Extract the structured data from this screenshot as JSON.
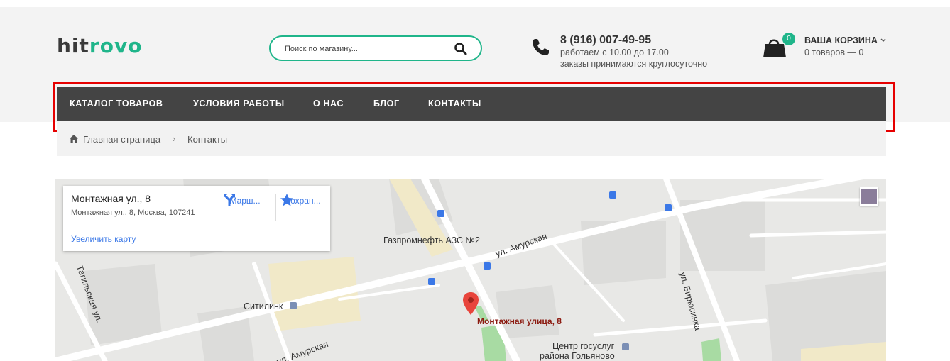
{
  "logo": {
    "prefix": "hit",
    "suffix": "rovo"
  },
  "search": {
    "placeholder": "Поиск по магазину..."
  },
  "contact": {
    "phone": "8 (916) 007-49-95",
    "hours": "работаем с 10.00 до 17.00",
    "orders": "заказы принимаются круглосуточно"
  },
  "cart": {
    "title": "ВАША КОРЗИНА",
    "count": "0",
    "summary": "0 товаров — 0"
  },
  "nav": {
    "items": [
      {
        "label": "КАТАЛОГ ТОВАРОВ"
      },
      {
        "label": "УСЛОВИЯ РАБОТЫ"
      },
      {
        "label": "О НАС"
      },
      {
        "label": "БЛОГ"
      },
      {
        "label": "КОНТАКТЫ"
      }
    ]
  },
  "breadcrumb": {
    "home": "Главная страница",
    "current": "Контакты"
  },
  "map": {
    "card": {
      "title": "Монтажная ул., 8",
      "address": "Монтажная ул., 8, Москва, 107241",
      "route": "Марш...",
      "save": "Сохран...",
      "enlarge": "Увеличить карту"
    },
    "labels": {
      "gas_station": "Газпромнефть АЗС №2",
      "amurskaya_top": "ул. Амурская",
      "amurskaya_bottom": "ул. Амурская",
      "tagilskaya": "Тагильская ул.",
      "biryusinka": "ул. Бирюсинка",
      "citilink": "Ситилинк",
      "marker": "Монтажная улица, 8",
      "gosuslugi_1": "Центр госуслуг",
      "gosuslugi_2": "района Гольяново"
    }
  },
  "colors": {
    "accent": "#1fb58a",
    "nav_bg": "#444444",
    "highlight": "#e60000",
    "marker": "#e8453c"
  }
}
